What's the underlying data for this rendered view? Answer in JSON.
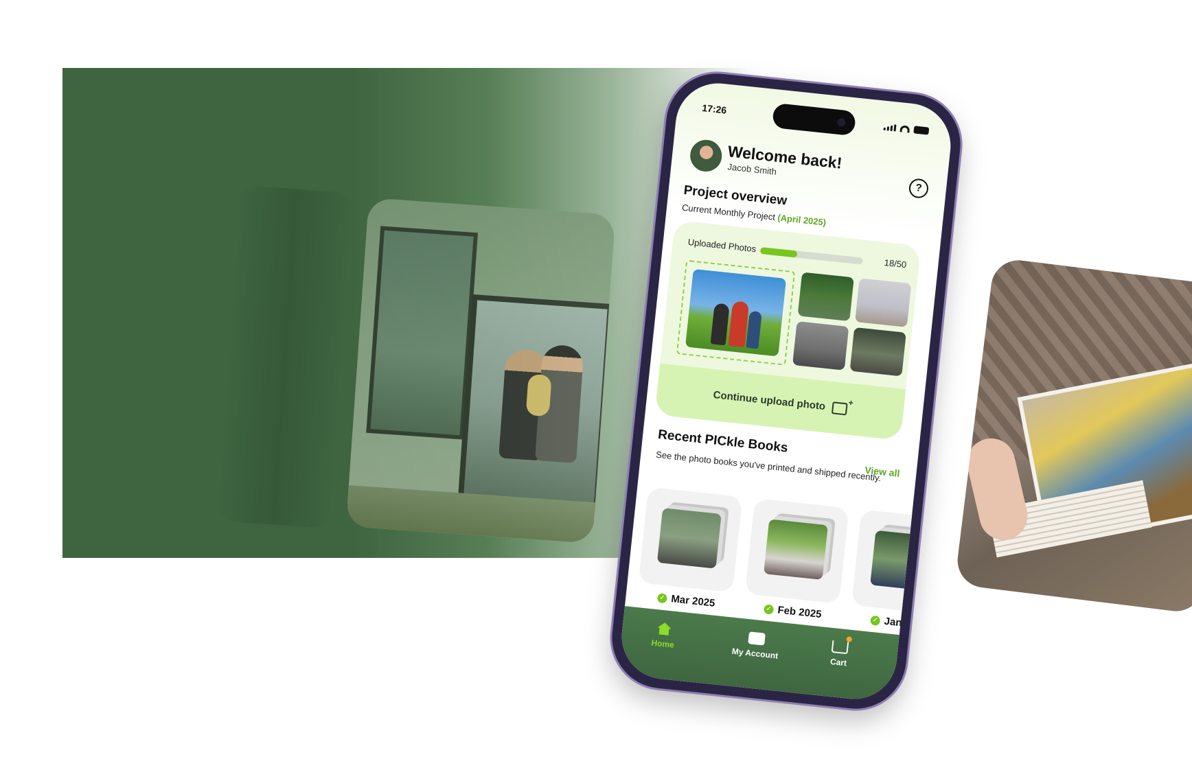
{
  "phone": {
    "status_bar": {
      "time": "17:26"
    },
    "header": {
      "welcome": "Welcome back!",
      "user_name": "Jacob Smith"
    },
    "project_overview": {
      "title": "Project overview",
      "subtitle": "Current Monthly Project",
      "period": "(April 2025)",
      "uploaded_label": "Uploaded Photos",
      "uploaded_count": 18,
      "uploaded_total": 50,
      "uploaded_text": "18/50",
      "continue_label": "Continue upload photo"
    },
    "recent_books": {
      "title": "Recent PICkle Books",
      "subtitle": "See the photo books you've printed and shipped recently.",
      "view_all": "View all",
      "items": [
        {
          "date": "Mar 2025"
        },
        {
          "date": "Feb 2025"
        },
        {
          "date": "Jan"
        }
      ]
    },
    "tabbar": {
      "items": [
        {
          "label": "Home",
          "icon": "home-icon",
          "active": true
        },
        {
          "label": "My Account",
          "icon": "wallet-icon",
          "active": false
        },
        {
          "label": "Cart",
          "icon": "cart-icon",
          "active": false
        }
      ]
    }
  },
  "colors": {
    "brand_green": "#3e6440",
    "accent_green": "#76c61d",
    "accent_text": "#5ea822",
    "cta_bg": "#d6f3b3"
  }
}
